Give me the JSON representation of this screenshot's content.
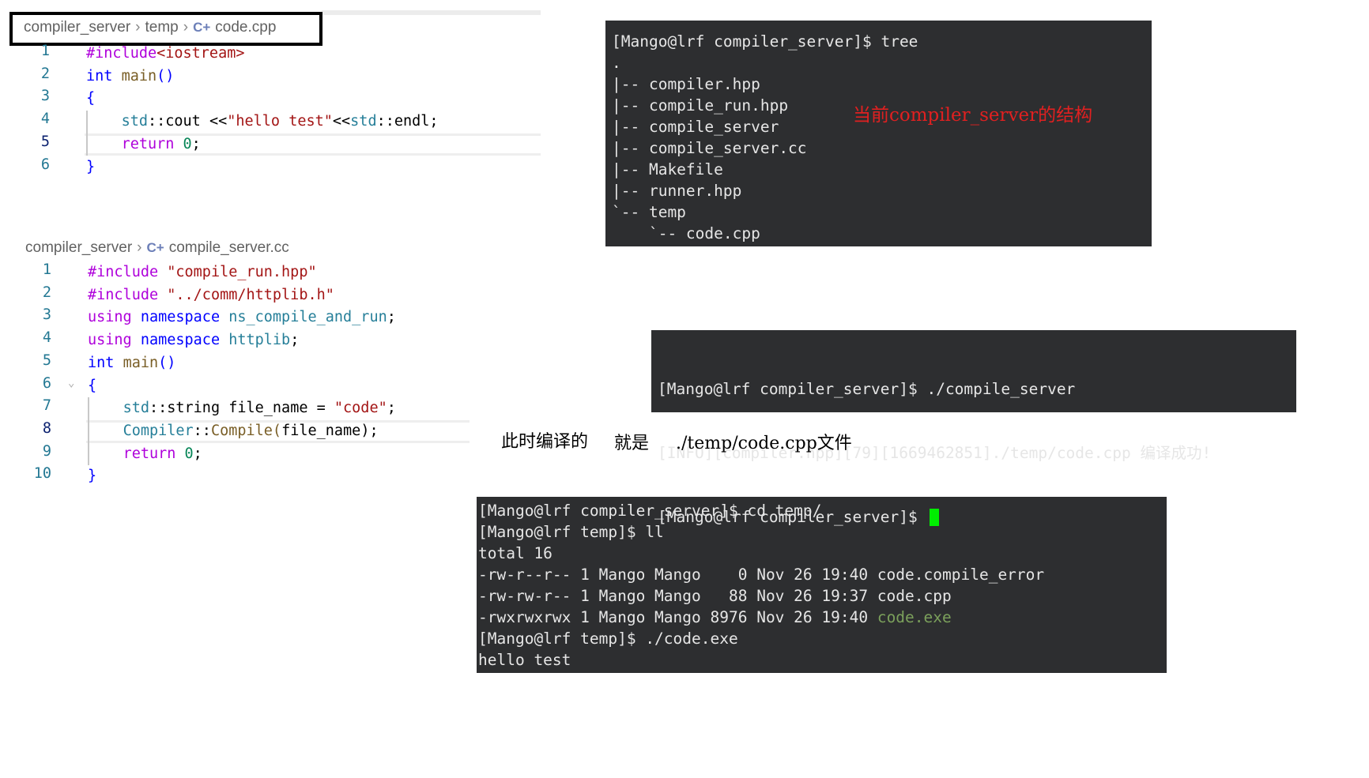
{
  "editor1": {
    "breadcrumb": [
      "compiler_server",
      "temp",
      "code.cpp"
    ],
    "file_icon": "cpp-file-icon",
    "lines": [
      [
        {
          "t": "#include",
          "c": "pp"
        },
        {
          "t": "<iostream>",
          "c": "s"
        }
      ],
      [
        {
          "t": "int",
          "c": "k"
        },
        {
          "t": " ",
          "c": "p"
        },
        {
          "t": "main",
          "c": "f"
        },
        {
          "t": "()",
          "c": "k"
        }
      ],
      [
        {
          "t": "{",
          "c": "k"
        }
      ],
      [
        {
          "t": "    ",
          "c": "p"
        },
        {
          "t": "std",
          "c": "t"
        },
        {
          "t": "::cout <<",
          "c": "p"
        },
        {
          "t": "\"hello test\"",
          "c": "s"
        },
        {
          "t": "<<",
          "c": "p"
        },
        {
          "t": "std",
          "c": "t"
        },
        {
          "t": "::endl;",
          "c": "p"
        }
      ],
      [
        {
          "t": "    ",
          "c": "p"
        },
        {
          "t": "return",
          "c": "pp"
        },
        {
          "t": " ",
          "c": "p"
        },
        {
          "t": "0",
          "c": "n"
        },
        {
          "t": ";",
          "c": "p"
        }
      ],
      [
        {
          "t": "}",
          "c": "k"
        }
      ]
    ],
    "active_line": 5
  },
  "editor2": {
    "breadcrumb": [
      "compiler_server",
      "compile_server.cc"
    ],
    "file_icon": "cpp-file-icon",
    "lines": [
      [
        {
          "t": "#include",
          "c": "pp"
        },
        {
          "t": " ",
          "c": "p"
        },
        {
          "t": "\"compile_run.hpp\"",
          "c": "s"
        }
      ],
      [
        {
          "t": "#include",
          "c": "pp"
        },
        {
          "t": " ",
          "c": "p"
        },
        {
          "t": "\"../comm/httplib.h\"",
          "c": "s"
        }
      ],
      [
        {
          "t": "using",
          "c": "pp"
        },
        {
          "t": " ",
          "c": "p"
        },
        {
          "t": "namespace",
          "c": "k"
        },
        {
          "t": " ",
          "c": "p"
        },
        {
          "t": "ns_compile_and_run",
          "c": "t"
        },
        {
          "t": ";",
          "c": "p"
        }
      ],
      [
        {
          "t": "using",
          "c": "pp"
        },
        {
          "t": " ",
          "c": "p"
        },
        {
          "t": "namespace",
          "c": "k"
        },
        {
          "t": " ",
          "c": "p"
        },
        {
          "t": "httplib",
          "c": "t"
        },
        {
          "t": ";",
          "c": "p"
        }
      ],
      [
        {
          "t": "int",
          "c": "k"
        },
        {
          "t": " ",
          "c": "p"
        },
        {
          "t": "main",
          "c": "f"
        },
        {
          "t": "()",
          "c": "k"
        }
      ],
      [
        {
          "t": "{",
          "c": "k"
        }
      ],
      [
        {
          "t": "    ",
          "c": "p"
        },
        {
          "t": "std",
          "c": "t"
        },
        {
          "t": "::string file_name = ",
          "c": "p"
        },
        {
          "t": "\"code\"",
          "c": "s"
        },
        {
          "t": ";",
          "c": "p"
        }
      ],
      [
        {
          "t": "    ",
          "c": "p"
        },
        {
          "t": "Compiler",
          "c": "t"
        },
        {
          "t": "::",
          "c": "p"
        },
        {
          "t": "Compile",
          "c": "f"
        },
        {
          "t": "(",
          "c": "f"
        },
        {
          "t": "file_name",
          "c": "p"
        },
        {
          "t": ");",
          "c": "p"
        }
      ],
      [
        {
          "t": "    ",
          "c": "p"
        },
        {
          "t": "return",
          "c": "pp"
        },
        {
          "t": " ",
          "c": "p"
        },
        {
          "t": "0",
          "c": "n"
        },
        {
          "t": ";",
          "c": "p"
        }
      ],
      [
        {
          "t": "}",
          "c": "k"
        }
      ]
    ],
    "active_line": 8
  },
  "terminal_tree": {
    "lines": [
      "[Mango@lrf compiler_server]$ tree",
      ".",
      "|-- compiler.hpp",
      "|-- compile_run.hpp",
      "|-- compile_server",
      "|-- compile_server.cc",
      "|-- Makefile",
      "|-- runner.hpp",
      "`-- temp",
      "    `-- code.cpp"
    ],
    "annotation": "当前compiler_server的结构",
    "annotation_color": "#e02020"
  },
  "terminal_run": {
    "lines": [
      "[Mango@lrf compiler_server]$ ./compile_server",
      "[INFO][compiler.hpp][79][1669462851]./temp/code.cpp 编译成功!",
      "[Mango@lrf compiler_server]$ "
    ],
    "cursor_color": "#00ee00"
  },
  "note": {
    "part1": "此时编译的",
    "part2": "就是",
    "part3": "./temp/code.cpp文件"
  },
  "terminal_ll": {
    "lines": [
      {
        "text": "[Mango@lrf compiler_server]$ cd temp/"
      },
      {
        "text": "[Mango@lrf temp]$ ll"
      },
      {
        "text": "total 16"
      },
      {
        "text": "-rw-r--r-- 1 Mango Mango    0 Nov 26 19:40 code.compile_error"
      },
      {
        "text": "-rw-rw-r-- 1 Mango Mango   88 Nov 26 19:37 code.cpp"
      },
      {
        "text": "-rwxrwxrwx 1 Mango Mango 8976 Nov 26 19:40 ",
        "exe": "code.exe"
      },
      {
        "text": "[Mango@lrf temp]$ ./code.exe"
      },
      {
        "text": "hello test"
      }
    ],
    "exe_color": "#7ba05b"
  }
}
